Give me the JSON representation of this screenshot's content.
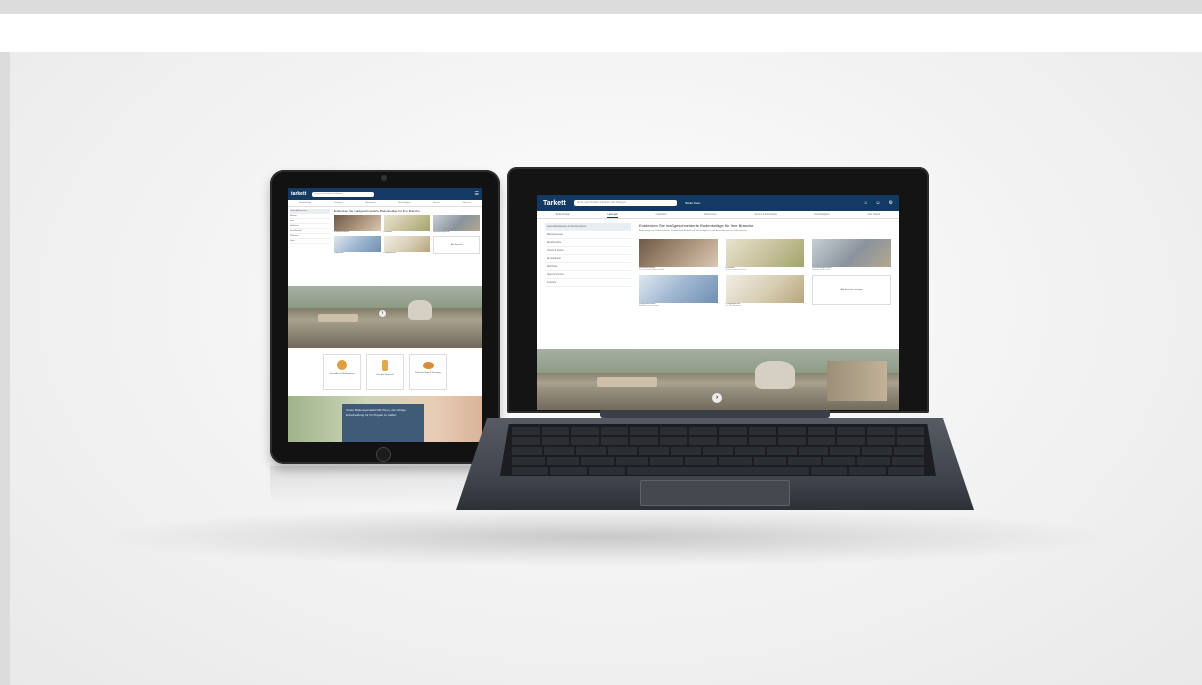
{
  "tablet": {
    "logo": "tarkett",
    "search_placeholder": "Suche nach Produkt, Kollektion ...",
    "nav_items": [
      "Bodenbeläge",
      "Lösungen",
      "Referenzen",
      "Nachhaltigkeit",
      "Service",
      "Über uns"
    ],
    "page_title": "Entdecken Sie maßgeschneiderte Bodenbeläge für Ihre Branche",
    "sidebar_items": [
      "Gesundheitswesen",
      "Bildung",
      "Büro",
      "Hotellerie",
      "Einzelhandel",
      "Wohnbau",
      "Sport"
    ],
    "product_captions": [
      "Patientenzimmer",
      "Korridore",
      "Behandlungsraum",
      "Diagnostik",
      "Pflegebereich"
    ],
    "all_link": "Alle Bereiche",
    "features": [
      {
        "label": "Gesundheit & Wohlbefinden"
      },
      {
        "label": "Zirkuläre Wirtschaft"
      },
      {
        "label": "Einfache Pflege & Reinigung"
      }
    ],
    "promo_text": "Unser Bodenspezialist hilft Ihnen, die richtige Entscheidung für Ihr Projekt zu treffen"
  },
  "laptop": {
    "logo": "Tarkett",
    "search_placeholder": "Suche nach Produkt, Kollektion oder Referenz",
    "store_link": "Händler finden",
    "header_icons": [
      "cart-icon",
      "user-icon",
      "account-icon"
    ],
    "nav_items": [
      "Bodenbeläge",
      "Lösungen",
      "Inspiration",
      "Referenzen",
      "Service & Downloads",
      "Nachhaltigkeit",
      "Über Tarkett"
    ],
    "page_title": "Entdecken Sie maßgeschneiderte Bodenbeläge für Ihre Branche",
    "intro_text": "Bodenbeläge von Tarkett verbinden Funktionalität, Ästhetik und Nachhaltigkeit für jede Anwendung im Gesundheitswesen.",
    "sidebar_items": [
      "Gesundheitswesen & Seniorenheime",
      "Bildungswesen",
      "Bürobereiche",
      "Hotels & Gastro",
      "Einzelhandel",
      "Wohnbau",
      "Sport & Freizeit",
      "Industrie"
    ],
    "products": [
      {
        "title": "Patientenzimmer",
        "subtitle": "Für ein komfortables Umfeld"
      },
      {
        "title": "Korridore",
        "subtitle": "Robust und pflegeleicht"
      },
      {
        "title": "Behandlungsräume",
        "subtitle": "Hygienisch & sicher"
      },
      {
        "title": "Diagnostikräume",
        "subtitle": "Ableitfähige Lösungen"
      },
      {
        "title": "Pflegebereiche",
        "subtitle": "Für Wohlbefinden"
      }
    ],
    "all_link": "Alle Bereiche anzeigen"
  }
}
